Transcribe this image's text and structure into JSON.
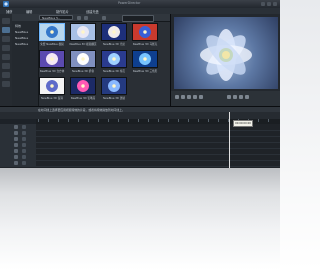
{
  "titlebar": {
    "title": "PowerDirector"
  },
  "mode_tabs": [
    "捕获",
    "编辑",
    "制作影片",
    "创建光盘"
  ],
  "media_toolbar": {
    "filter": "NewBlue 5.."
  },
  "tree": [
    "特效",
    "NewBlue",
    "NewBlue",
    "NewBlue"
  ],
  "effects": [
    {
      "label": "免费 NewBlue 视频",
      "bg": "#b8d7ef",
      "fg": "#3577c9",
      "selected": true
    },
    {
      "label": "NewBlue 3D 视频翻页",
      "bg": "#a8c0e6",
      "fg": "#e8e8f5",
      "selected": false
    },
    {
      "label": "NewBlue 3D 光斑",
      "bg": "#1d2f7a",
      "fg": "#f1ece9",
      "selected": false
    },
    {
      "label": "NewBlue 3D 马赛克",
      "bg": "#c93a2e",
      "fg": "#3a5ed6",
      "selected": false
    },
    {
      "label": "NewBlue 3D 立方体",
      "bg": "#5b4ab0",
      "fg": "#f4e8f5",
      "selected": false
    },
    {
      "label": "NewBlue 3D 折叠",
      "bg": "#8090c0",
      "fg": "#ffffff",
      "selected": false
    },
    {
      "label": "NewBlue 3D 卷页",
      "bg": "#2a3b8f",
      "fg": "#9fd0ff",
      "selected": false
    },
    {
      "label": "NewBlue 3D 三角形",
      "bg": "#0e3f8f",
      "fg": "#77c4ff",
      "selected": false
    },
    {
      "label": "NewBlue 3D 漩涡",
      "bg": "#f4f4f4",
      "fg": "#5e6bc9",
      "selected": false
    },
    {
      "label": "NewBlue 3D 铅笔画",
      "bg": "#1c2a66",
      "fg": "#ff59b5",
      "selected": false
    },
    {
      "label": "NewBlue 3D 透镜",
      "bg": "#243a80",
      "fg": "#89b8ff",
      "selected": false
    }
  ],
  "status": {
    "text": "在时间线上选择要应用视频特效的片段，或者将特效拖放到时间线上。"
  },
  "timeline": {
    "tooltip": "00:00:00:00"
  }
}
